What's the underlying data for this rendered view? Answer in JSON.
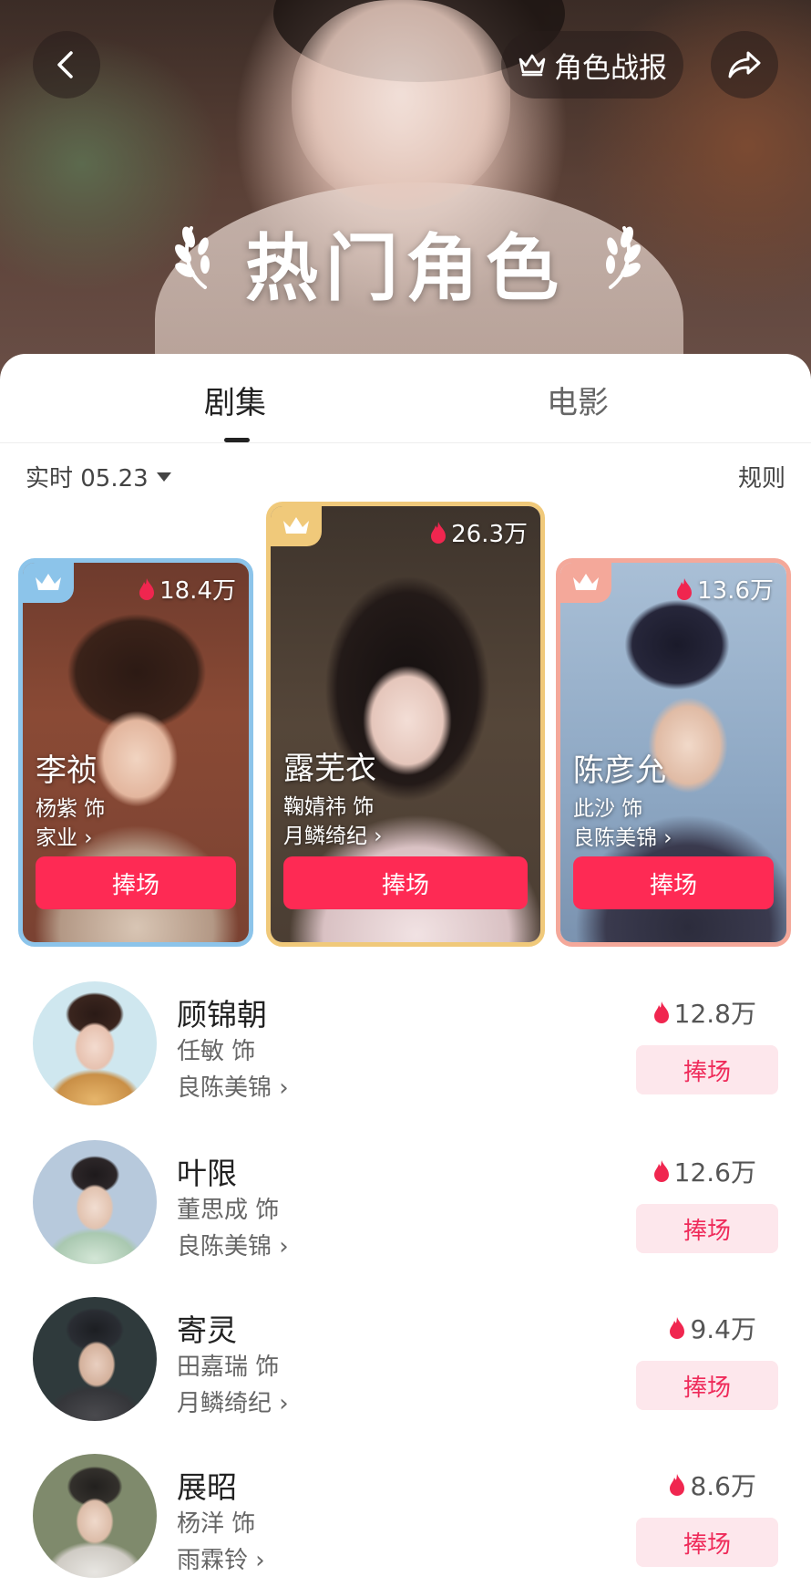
{
  "header": {
    "report_label": "角色战报",
    "title": "热门角色",
    "back_icon": "chevron-left-icon",
    "share_icon": "share-arrow-icon",
    "report_icon": "crown-icon"
  },
  "tabs": [
    {
      "label": "剧集",
      "active": true
    },
    {
      "label": "电影",
      "active": false
    }
  ],
  "filter": {
    "label": "实时 05.23",
    "rules_label": "规则"
  },
  "top3": [
    {
      "rank": 2,
      "role": "李祯",
      "actor": "杨紫 饰",
      "drama": "家业",
      "heat": "18.4万",
      "button": "捧场",
      "frame_color": "#8cc4ea"
    },
    {
      "rank": 1,
      "role": "露芜衣",
      "actor": "鞠婧祎 饰",
      "drama": "月鳞绮纪",
      "heat": "26.3万",
      "button": "捧场",
      "frame_color": "#f0c97a"
    },
    {
      "rank": 3,
      "role": "陈彦允",
      "actor": "此沙 饰",
      "drama": "良陈美锦",
      "heat": "13.6万",
      "button": "捧场",
      "frame_color": "#f4a89a"
    }
  ],
  "list": [
    {
      "role": "顾锦朝",
      "actor": "任敏 饰",
      "drama": "良陈美锦",
      "heat": "12.8万",
      "button": "捧场"
    },
    {
      "role": "叶限",
      "actor": "董思成 饰",
      "drama": "良陈美锦",
      "heat": "12.6万",
      "button": "捧场"
    },
    {
      "role": "寄灵",
      "actor": "田嘉瑞 饰",
      "drama": "月鳞绮纪",
      "heat": "9.4万",
      "button": "捧场"
    },
    {
      "role": "展昭",
      "actor": "杨洋 饰",
      "drama": "雨霖铃",
      "heat": "8.6万",
      "button": "捧场"
    }
  ],
  "colors": {
    "accent": "#fe2a54",
    "soft_button_bg": "#fde7ec",
    "soft_button_text": "#ef2b5a",
    "flame": "#f0264f"
  }
}
